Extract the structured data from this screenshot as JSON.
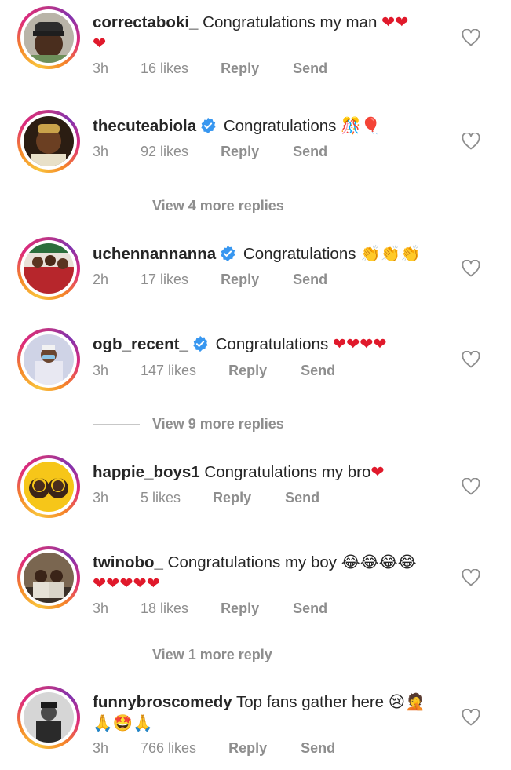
{
  "comments": [
    {
      "username": "correctaboki_",
      "verified": false,
      "text": "Congratulations my man",
      "emoji": "❤❤",
      "emoji2": "❤",
      "time": "3h",
      "likes": "16 likes",
      "reply": "Reply",
      "send": "Send"
    },
    {
      "username": "thecuteabiola",
      "verified": true,
      "text": "Congratulations",
      "emoji": "🎊🎈",
      "time": "3h",
      "likes": "92 likes",
      "reply": "Reply",
      "send": "Send"
    },
    {
      "username": "uchennannanna",
      "verified": true,
      "text": "Congratulations",
      "emoji": "👏👏👏",
      "time": "2h",
      "likes": "17 likes",
      "reply": "Reply",
      "send": "Send"
    },
    {
      "username": "ogb_recent_",
      "verified": true,
      "text": "Congratulations",
      "emoji": "❤❤❤❤",
      "time": "3h",
      "likes": "147 likes",
      "reply": "Reply",
      "send": "Send"
    },
    {
      "username": "happie_boys1",
      "verified": false,
      "text": "Congratulations my bro",
      "emoji": "❤",
      "time": "3h",
      "likes": "5 likes",
      "reply": "Reply",
      "send": "Send"
    },
    {
      "username": "twinobo_",
      "verified": false,
      "text": "Congratulations my boy",
      "emoji": "😂😂😂😂",
      "emoji2": "❤❤❤❤❤",
      "time": "3h",
      "likes": "18 likes",
      "reply": "Reply",
      "send": "Send"
    },
    {
      "username": "funnybroscomedy",
      "verified": false,
      "text": "Top fans gather here",
      "emoji": "😢🤦",
      "emoji2": "🙏🤩🙏",
      "time": "3h",
      "likes": "766 likes",
      "reply": "Reply",
      "send": "Send"
    }
  ],
  "view_more": [
    {
      "label": "View 4 more replies"
    },
    {
      "label": "View 9 more replies"
    },
    {
      "label": "View 1 more reply"
    }
  ],
  "icons": {
    "like": "heart-outline-icon",
    "verified": "verified-badge-icon"
  },
  "colors": {
    "text": "#262626",
    "meta": "#8e8e8e",
    "verified": "#3897f0",
    "heart": "#e0192b"
  }
}
